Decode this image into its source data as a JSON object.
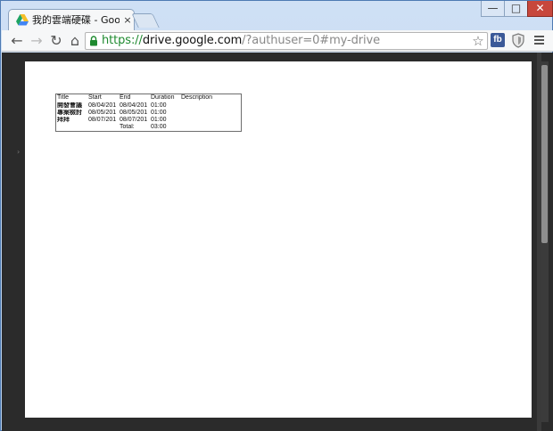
{
  "browser": {
    "tab": {
      "title": "我的雲端硬碟 - Google 雲",
      "close": "×"
    },
    "window_buttons": {
      "minimize": "—",
      "maximize": "□",
      "close": "✕"
    },
    "toolbar": {
      "back": "←",
      "forward": "→",
      "reload": "↻",
      "home": "⌂",
      "url_protocol": "https://",
      "url_host": "drive.google.com",
      "url_path": "/?authuser=0#my-drive",
      "bookmark_star": "☆",
      "fb_extension": "fb"
    }
  },
  "document": {
    "headers": [
      "Title",
      "Start",
      "End",
      "Duration",
      "Description"
    ],
    "rows": [
      {
        "title": "開發會議",
        "start": "08/04/201",
        "end": "08/04/201",
        "duration": "01:00",
        "description": ""
      },
      {
        "title": "專案檢討",
        "start": "08/05/201",
        "end": "08/05/201",
        "duration": "01:00",
        "description": ""
      },
      {
        "title": "拜拜",
        "start": "08/07/201",
        "end": "08/07/201",
        "duration": "01:00",
        "description": ""
      }
    ],
    "total_label": "Total:",
    "total_value": "03:00"
  },
  "colors": {
    "url_protocol": "#1e8a2f",
    "window_close": "#c7473c",
    "fb_blue": "#3b5998",
    "preview_background": "#2b2b2b"
  },
  "icons": {
    "tab_icon": "google-drive-icon",
    "lock": "lock-icon",
    "shield_extension": "shield-icon",
    "menu": "hamburger-menu-icon"
  }
}
